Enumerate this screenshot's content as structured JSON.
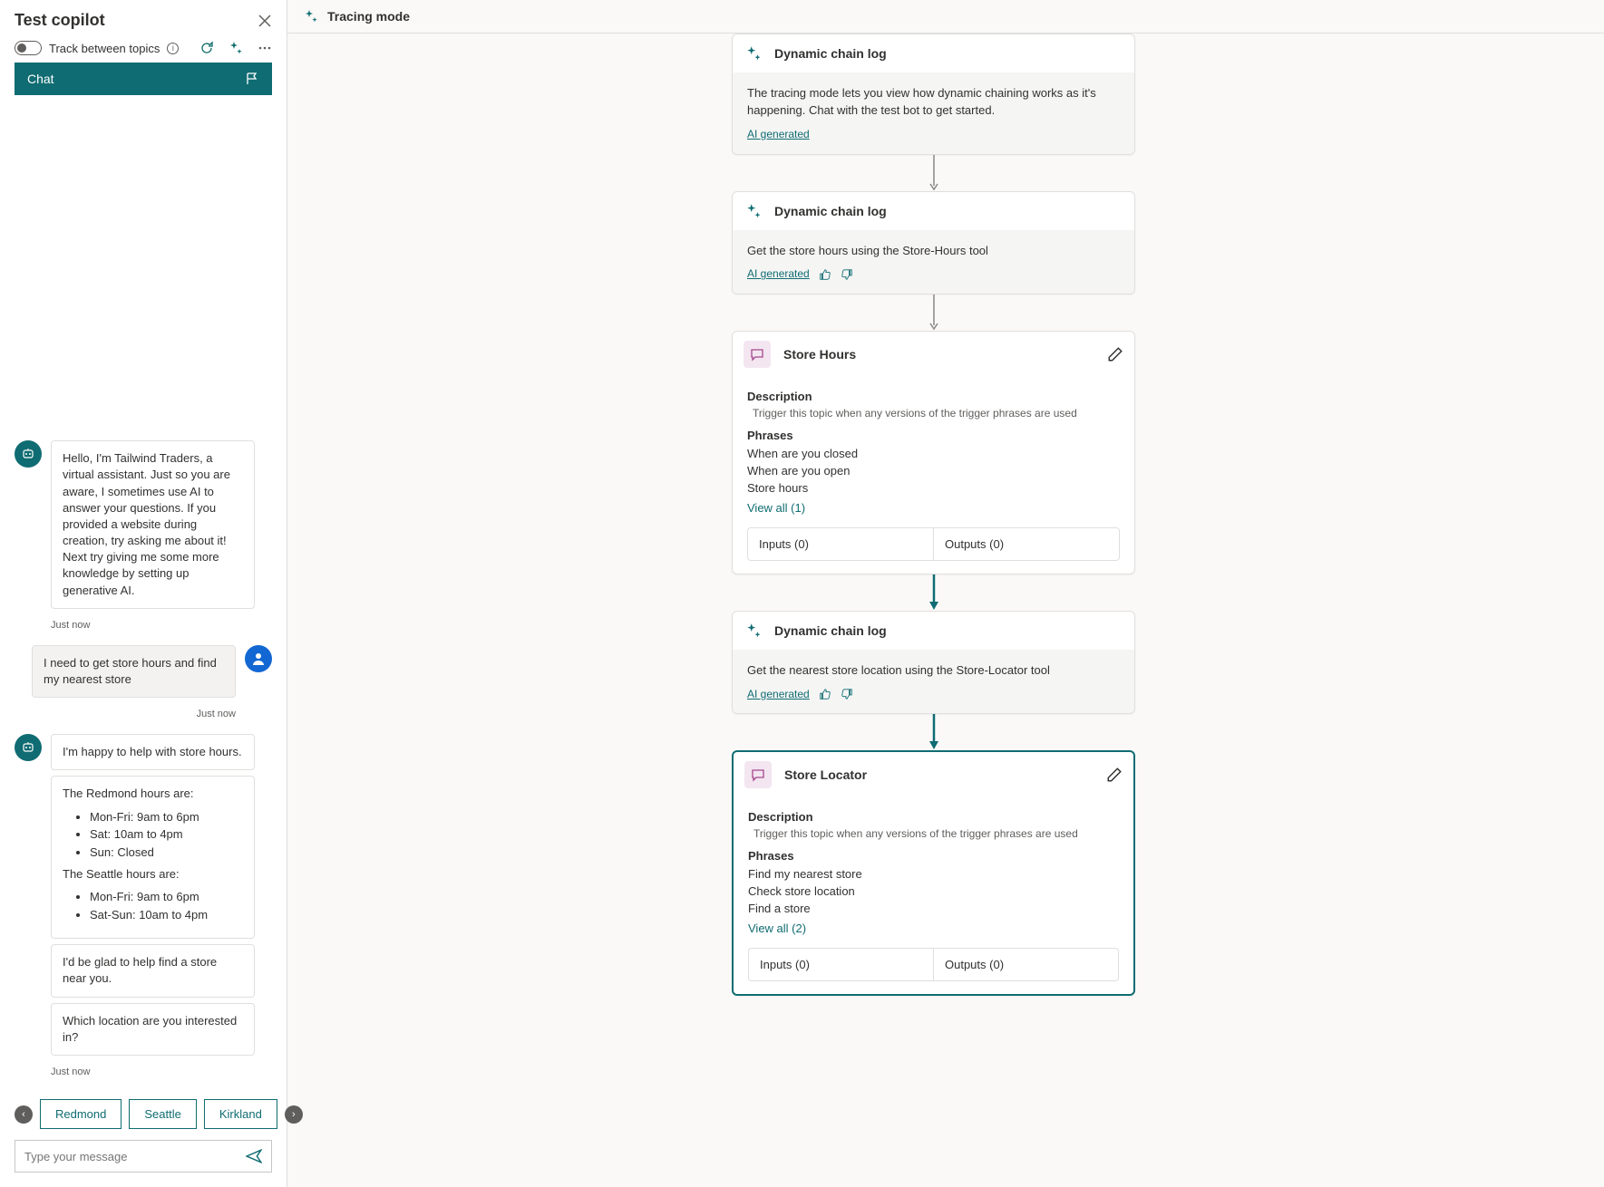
{
  "leftPanel": {
    "title": "Test copilot",
    "trackLabel": "Track between topics",
    "chatTab": "Chat",
    "messages": {
      "botIntro": "Hello, I'm Tailwind Traders, a virtual assistant. Just so you are aware, I sometimes use AI to answer your questions. If you provided a website during creation, try asking me about it! Next try giving me some more knowledge by setting up generative AI.",
      "botIntroTime": "Just now",
      "userMsg": "I need to get store hours and find my nearest store",
      "userMsgTime": "Just now",
      "botHelp": "I'm happy to help with store hours.",
      "hoursRedmondTitle": "The Redmond hours are:",
      "hoursRedmond": [
        "Mon-Fri: 9am to 6pm",
        "Sat: 10am to 4pm",
        "Sun: Closed"
      ],
      "hoursSeattleTitle": "The Seattle hours are:",
      "hoursSeattle": [
        "Mon-Fri: 9am to 6pm",
        "Sat-Sun: 10am to 4pm"
      ],
      "botGlad": "I'd be glad to help find a store near you.",
      "botWhich": "Which location are you interested in?",
      "botTime2": "Just now"
    },
    "suggestions": [
      "Redmond",
      "Seattle",
      "Kirkland"
    ],
    "inputPlaceholder": "Type your message"
  },
  "rightPanel": {
    "title": "Tracing mode",
    "nodes": {
      "log1": {
        "title": "Dynamic chain log",
        "body": "The tracing mode lets you view how dynamic chaining works as it's happening. Chat with the test bot to get started.",
        "aiGen": "AI generated"
      },
      "log2": {
        "title": "Dynamic chain log",
        "body": "Get the store hours using the Store-Hours tool",
        "aiGen": "AI generated"
      },
      "topic1": {
        "title": "Store Hours",
        "descLabel": "Description",
        "desc": "Trigger this topic when any versions of the trigger phrases are used",
        "phrasesLabel": "Phrases",
        "phrases": [
          "When are you closed",
          "When are you open",
          "Store hours"
        ],
        "viewAll": "View all (1)",
        "inputs": "Inputs (0)",
        "outputs": "Outputs (0)"
      },
      "log3": {
        "title": "Dynamic chain log",
        "body": "Get the nearest store location using the Store-Locator tool",
        "aiGen": "AI generated"
      },
      "topic2": {
        "title": "Store Locator",
        "descLabel": "Description",
        "desc": "Trigger this topic when any versions of the trigger phrases are used",
        "phrasesLabel": "Phrases",
        "phrases": [
          "Find my nearest store",
          "Check store location",
          "Find a store"
        ],
        "viewAll": "View all (2)",
        "inputs": "Inputs (0)",
        "outputs": "Outputs (0)"
      }
    }
  }
}
